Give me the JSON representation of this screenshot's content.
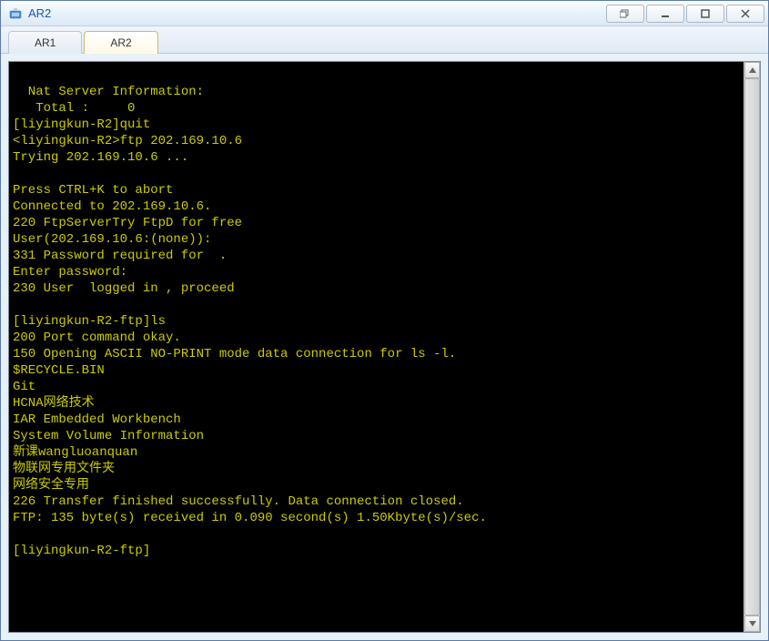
{
  "window": {
    "title": "AR2"
  },
  "tabs": [
    {
      "label": "AR1",
      "active": false
    },
    {
      "label": "AR2",
      "active": true
    }
  ],
  "terminal": {
    "lines": [
      "                                                                                ",
      "  Nat Server Information:",
      "   Total :     0",
      "[liyingkun-R2]quit",
      "<liyingkun-R2>ftp 202.169.10.6",
      "Trying 202.169.10.6 ...",
      "",
      "Press CTRL+K to abort",
      "Connected to 202.169.10.6.",
      "220 FtpServerTry FtpD for free",
      "User(202.169.10.6:(none)):",
      "331 Password required for  .",
      "Enter password:",
      "230 User  logged in , proceed",
      "",
      "[liyingkun-R2-ftp]ls",
      "200 Port command okay.",
      "150 Opening ASCII NO-PRINT mode data connection for ls -l.",
      "$RECYCLE.BIN",
      "Git",
      "HCNA网络技术",
      "IAR Embedded Workbench",
      "System Volume Information",
      "新课wangluoanquan",
      "物联网专用文件夹",
      "网络安全专用",
      "226 Transfer finished successfully. Data connection closed.",
      "FTP: 135 byte(s) received in 0.090 second(s) 1.50Kbyte(s)/sec.",
      "",
      "[liyingkun-R2-ftp]"
    ]
  },
  "colors": {
    "terminal_bg": "#000000",
    "terminal_fg": "#cccc00"
  }
}
